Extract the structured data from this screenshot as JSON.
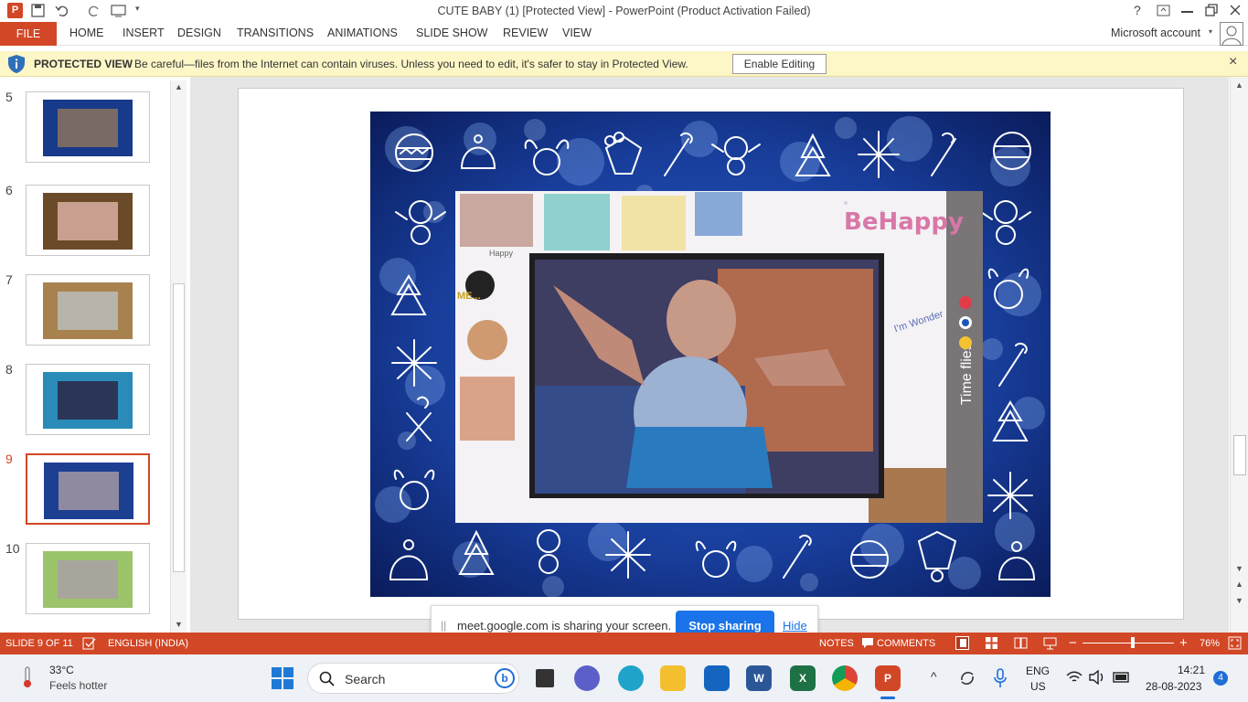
{
  "window": {
    "title": "CUTE BABY (1) [Protected View] - PowerPoint (Product Activation Failed)",
    "help": "?",
    "account": "Microsoft account"
  },
  "ribbon": {
    "tabs": [
      "FILE",
      "HOME",
      "INSERT",
      "DESIGN",
      "TRANSITIONS",
      "ANIMATIONS",
      "SLIDE SHOW",
      "REVIEW",
      "VIEW"
    ]
  },
  "protected": {
    "label": "PROTECTED VIEW",
    "message": "Be careful—files from the Internet can contain viruses. Unless you need to edit, it's safer to stay in Protected View.",
    "button": "Enable Editing",
    "close": "×"
  },
  "thumbnails": [
    {
      "num": "5",
      "bg": "#173a8a",
      "photo": "#7a6a66"
    },
    {
      "num": "6",
      "bg": "#6b4a2a",
      "photo": "#c9a08f"
    },
    {
      "num": "7",
      "bg": "#a8824e",
      "photo": "#b8b4aa"
    },
    {
      "num": "8",
      "bg": "#2a8bb8",
      "photo": "#2b3558"
    },
    {
      "num": "9",
      "bg": "#1d3f92",
      "photo": "#8f8aa0"
    },
    {
      "num": "10",
      "bg": "#9bc46b",
      "photo": "#a8a69c"
    }
  ],
  "slide": {
    "photo_texts": {
      "behappy": "BeHappy",
      "timeflies": "Time flies.",
      "happy": "Happy",
      "me": "ME...",
      "wonder": "I'm Wonder"
    }
  },
  "sharing": {
    "grip": "||",
    "message": "meet.google.com is sharing your screen.",
    "stop": "Stop sharing",
    "hide": "Hide"
  },
  "status": {
    "slide": "SLIDE 9 OF 11",
    "language": "ENGLISH (INDIA)",
    "notes": "NOTES",
    "comments": "COMMENTS",
    "zoom": "76%",
    "zoom_fraction": 0.55
  },
  "taskbar": {
    "temp": "33°C",
    "weather": "Feels hotter",
    "search": "Search",
    "lang1": "ENG",
    "lang2": "US",
    "time": "14:21",
    "date": "28-08-2023",
    "badge": "4"
  }
}
